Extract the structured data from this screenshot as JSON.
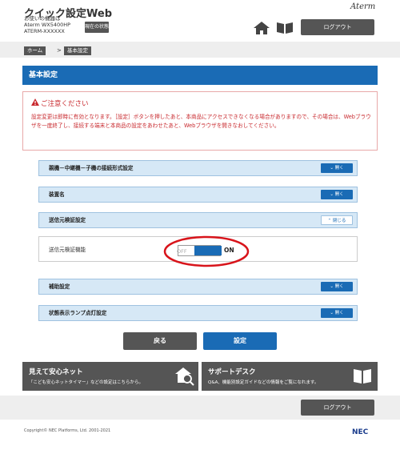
{
  "header": {
    "app_title": "クイック設定Web",
    "device_label": "お使いの機器は",
    "device_model": "Aterm WX5400HP",
    "device_id": "ATERM-XXXXXX",
    "status_button": "現在の状態",
    "brand": "Aterm",
    "logout": "ログアウト",
    "icons": [
      "home-icon",
      "manual-book-icon"
    ]
  },
  "breadcrumb": {
    "home": "ホーム",
    "separator": ">",
    "current": "基本設定"
  },
  "page_title": "基本設定",
  "notice": {
    "title": "ご注意ください",
    "text": "設定変更は即時に有効となります。［設定］ボタンを押したあと、本商品にアクセスできなくなる場合がありますので、その場合は、Webブラウザを一度終了し、接続する端末と本商品の設定をあわせたあと、Webブラウザを開きなおしてください。"
  },
  "accordions": [
    {
      "label": "親機－中継機－子機の接続形式設定",
      "button": "開く"
    },
    {
      "label": "装置名",
      "button": "開く"
    },
    {
      "label": "送信元検証設定",
      "button": "閉じる"
    },
    {
      "label": "補助設定",
      "button": "開く"
    },
    {
      "label": "状態表示ランプ点灯設定",
      "button": "開く"
    }
  ],
  "source_verify": {
    "label": "送信元検証機能",
    "off_label": "OFF",
    "on_label": "ON",
    "state": "ON"
  },
  "actions": {
    "back": "戻る",
    "set": "設定"
  },
  "cards": [
    {
      "title": "見えて安心ネット",
      "subtitle": "「こども安心ネットタイマー」などの設定はこちらから。",
      "icon": "home-search-icon"
    },
    {
      "title": "サポートデスク",
      "subtitle": "Q&A、機能別設定ガイドなどの情報をご覧になれます。",
      "icon": "book-icon"
    }
  ],
  "footer": {
    "logout": "ログアウト",
    "copyright": "Copyright© NEC Platforms, Ltd. 2001-2021",
    "logo": "NEC"
  },
  "colors": {
    "accent": "#1a6bb5",
    "warning": "#c8282d",
    "dark_button": "#555555"
  }
}
